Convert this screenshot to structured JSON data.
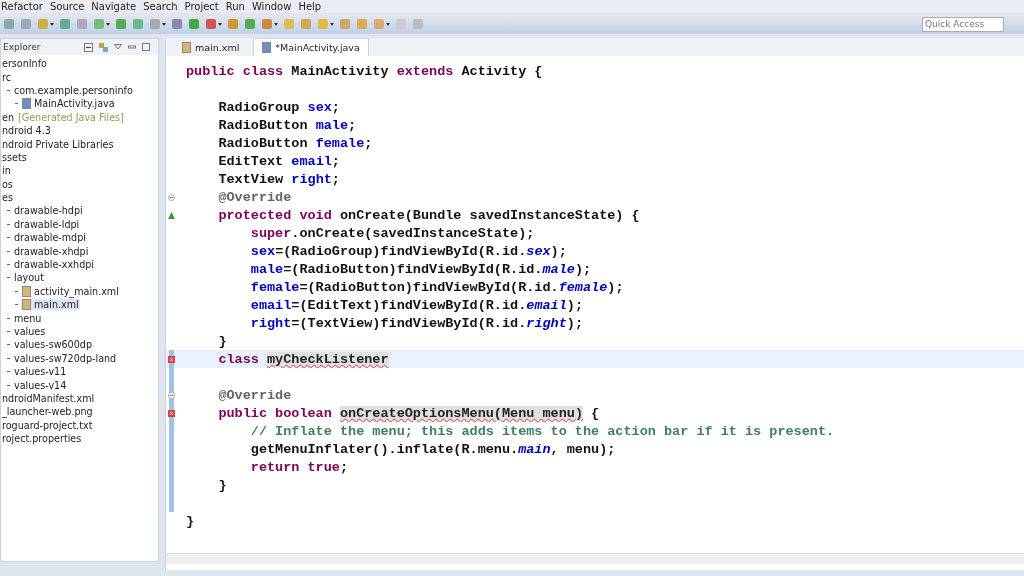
{
  "menu_bar": [
    "Refactor",
    "Source",
    "Navigate",
    "Search",
    "Project",
    "Run",
    "Window",
    "Help"
  ],
  "quick_access": {
    "placeholder": "Quick Access"
  },
  "explorer": {
    "title": "Explorer",
    "items": [
      {
        "label": "ersonInfo",
        "selected": false
      },
      {
        "label": "rc",
        "selected": false,
        "children": [
          {
            "label": "com.example.personinfo",
            "selected": false,
            "children": [
              {
                "label": "MainActivity.java",
                "kind": "java",
                "selected": false
              }
            ]
          }
        ]
      },
      {
        "label": "en",
        "decoration": "[Generated Java Files]",
        "selected": false
      },
      {
        "label": "ndroid 4.3",
        "selected": false
      },
      {
        "label": "ndroid Private Libraries",
        "selected": false
      },
      {
        "label": "ssets",
        "selected": false
      },
      {
        "label": "in",
        "selected": false
      },
      {
        "label": "os",
        "selected": false
      },
      {
        "label": "es",
        "selected": false,
        "children": [
          {
            "label": "drawable-hdpi",
            "selected": false
          },
          {
            "label": "drawable-ldpi",
            "selected": false
          },
          {
            "label": "drawable-mdpi",
            "selected": false
          },
          {
            "label": "drawable-xhdpi",
            "selected": false
          },
          {
            "label": "drawable-xxhdpi",
            "selected": false
          },
          {
            "label": "layout",
            "selected": false,
            "children": [
              {
                "label": "activity_main.xml",
                "kind": "xml",
                "selected": false
              },
              {
                "label": "main.xml",
                "kind": "xml",
                "selected": true
              }
            ]
          },
          {
            "label": "menu",
            "selected": false
          },
          {
            "label": "values",
            "selected": false
          },
          {
            "label": "values-sw600dp",
            "selected": false
          },
          {
            "label": "values-sw720dp-land",
            "selected": false
          },
          {
            "label": "values-v11",
            "selected": false
          },
          {
            "label": "values-v14",
            "selected": false
          }
        ]
      },
      {
        "label": "ndroidManifest.xml",
        "selected": false
      },
      {
        "label": "_launcher-web.png",
        "selected": false
      },
      {
        "label": "roguard-project.txt",
        "selected": false
      },
      {
        "label": "roject.properties",
        "selected": false
      }
    ]
  },
  "tabs": [
    {
      "label": "main.xml",
      "kind": "xml",
      "selected": false
    },
    {
      "label": "*MainActivity.java",
      "kind": "java",
      "selected": true
    }
  ],
  "code_lines": [
    {
      "tokens": [
        {
          "text": "public class",
          "kind": "keyword"
        },
        {
          "text": " MainActivity ",
          "kind": "plain"
        },
        {
          "text": "extends",
          "kind": "keyword"
        },
        {
          "text": " Activity {",
          "kind": "plain"
        }
      ]
    },
    {
      "blank_before": true,
      "tokens": [
        {
          "text": "    RadioGroup ",
          "kind": "plain"
        },
        {
          "text": "sex",
          "kind": "field"
        },
        {
          "text": ";",
          "kind": "plain"
        }
      ]
    },
    {
      "tokens": [
        {
          "text": "    RadioButton ",
          "kind": "plain"
        },
        {
          "text": "male",
          "kind": "field"
        },
        {
          "text": ";",
          "kind": "plain"
        }
      ]
    },
    {
      "tokens": [
        {
          "text": "    RadioButton ",
          "kind": "plain"
        },
        {
          "text": "female",
          "kind": "field"
        },
        {
          "text": ";",
          "kind": "plain"
        }
      ]
    },
    {
      "tokens": [
        {
          "text": "    EditText ",
          "kind": "plain"
        },
        {
          "text": "email",
          "kind": "field"
        },
        {
          "text": ";",
          "kind": "plain"
        }
      ]
    },
    {
      "tokens": [
        {
          "text": "    TextView ",
          "kind": "plain"
        },
        {
          "text": "right",
          "kind": "field"
        },
        {
          "text": ";",
          "kind": "plain"
        }
      ]
    },
    {
      "fold": true,
      "tokens": [
        {
          "text": "    @Override",
          "kind": "annotation"
        }
      ]
    },
    {
      "override": true,
      "tokens": [
        {
          "text": "    protected void",
          "kind": "keyword"
        },
        {
          "text": " onCreate(Bundle savedInstanceState) {",
          "kind": "plain"
        }
      ]
    },
    {
      "tokens": [
        {
          "text": "        super",
          "kind": "keyword"
        },
        {
          "text": ".onCreate(savedInstanceState);",
          "kind": "plain"
        }
      ]
    },
    {
      "tokens": [
        {
          "text": "        sex",
          "kind": "field"
        },
        {
          "text": "=(RadioGroup)findViewById(R.id.",
          "kind": "plain"
        },
        {
          "text": "sex",
          "kind": "static"
        },
        {
          "text": ");",
          "kind": "plain"
        }
      ]
    },
    {
      "tokens": [
        {
          "text": "        male",
          "kind": "field"
        },
        {
          "text": "=(RadioButton)findViewById(R.id.",
          "kind": "plain"
        },
        {
          "text": "male",
          "kind": "static"
        },
        {
          "text": ");",
          "kind": "plain"
        }
      ]
    },
    {
      "tokens": [
        {
          "text": "        female",
          "kind": "field"
        },
        {
          "text": "=(RadioButton)findViewById(R.id.",
          "kind": "plain"
        },
        {
          "text": "female",
          "kind": "static"
        },
        {
          "text": ");",
          "kind": "plain"
        }
      ]
    },
    {
      "tokens": [
        {
          "text": "        email",
          "kind": "field"
        },
        {
          "text": "=(EditText)findViewById(R.id.",
          "kind": "plain"
        },
        {
          "text": "email",
          "kind": "static"
        },
        {
          "text": ");",
          "kind": "plain"
        }
      ]
    },
    {
      "tokens": [
        {
          "text": "        right",
          "kind": "field"
        },
        {
          "text": "=(TextView)findViewById(R.id.",
          "kind": "plain"
        },
        {
          "text": "right",
          "kind": "static"
        },
        {
          "text": ");",
          "kind": "plain"
        }
      ]
    },
    {
      "tokens": [
        {
          "text": "    }",
          "kind": "plain"
        }
      ]
    },
    {
      "error": true,
      "current": true,
      "changed": true,
      "tokens": [
        {
          "text": "    class ",
          "kind": "keyword"
        },
        {
          "text": "myCheckListener",
          "kind": "error"
        }
      ]
    },
    {
      "changed": true
    },
    {
      "fold": true,
      "changed": true,
      "tokens": [
        {
          "text": "    @Override",
          "kind": "annotation"
        }
      ]
    },
    {
      "error": true,
      "changed": true,
      "tokens": [
        {
          "text": "    public boolean ",
          "kind": "keyword"
        },
        {
          "text": "onCreateOptionsMenu(Menu menu)",
          "kind": "error"
        },
        {
          "text": " {",
          "kind": "plain"
        }
      ]
    },
    {
      "changed": true,
      "tokens": [
        {
          "text": "        // Inflate the menu; this adds items to the action bar if it is present.",
          "kind": "comment"
        }
      ]
    },
    {
      "changed": true,
      "tokens": [
        {
          "text": "        getMenuInflater().inflate(R.menu.",
          "kind": "plain"
        },
        {
          "text": "main",
          "kind": "static"
        },
        {
          "text": ", menu);",
          "kind": "plain"
        }
      ]
    },
    {
      "changed": true,
      "tokens": [
        {
          "text": "        return true",
          "kind": "keyword"
        },
        {
          "text": ";",
          "kind": "plain"
        }
      ]
    },
    {
      "changed": true,
      "tokens": [
        {
          "text": "    }",
          "kind": "plain"
        }
      ]
    },
    {
      "changed": true
    },
    {
      "tokens": [
        {
          "text": "}",
          "kind": "plain"
        }
      ]
    }
  ]
}
